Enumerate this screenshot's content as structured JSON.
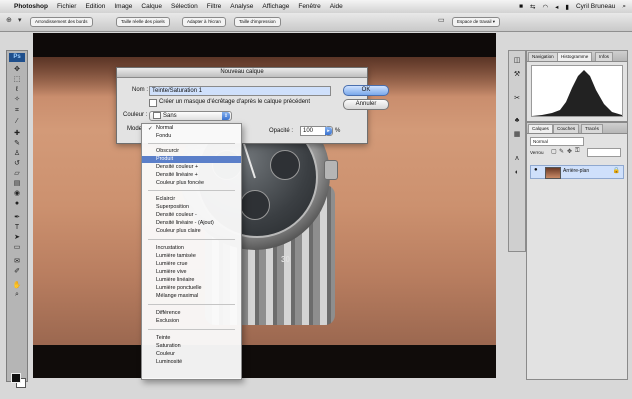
{
  "menubar": {
    "apple_icon": "apple-icon",
    "app": "Photoshop",
    "items": [
      "Fichier",
      "Edition",
      "Image",
      "Calque",
      "Sélection",
      "Filtre",
      "Analyse",
      "Affichage",
      "Fenêtre",
      "Aide"
    ],
    "user": "Cyril Bruneau"
  },
  "options_bar": {
    "smooth_label": "Arrondissement des bords",
    "refine_label": "Taille réelle des pixels",
    "fit_label": "Adapter à l'écran",
    "fill_label": "Taille d'impression",
    "workspace_label": "Espace de travail ▾"
  },
  "toolbox": {
    "logo": "Ps",
    "tools": [
      "move-icon",
      "marquee-icon",
      "lasso-icon",
      "wand-icon",
      "crop-icon",
      "eyedropper-icon",
      "heal-icon",
      "brush-icon",
      "stamp-icon",
      "history-brush-icon",
      "eraser-icon",
      "gradient-icon",
      "blur-icon",
      "dodge-icon",
      "pen-icon",
      "type-icon",
      "path-select-icon",
      "shape-icon",
      "notes-icon",
      "hand-icon",
      "zoom-icon"
    ]
  },
  "dialog": {
    "title": "Nouveau calque",
    "name_label": "Nom :",
    "name_value": "Teinte/Saturation 1",
    "clip_label": "Créer un masque d'écrêtage d'après le calque précédent",
    "color_label": "Couleur :",
    "color_value": "Sans",
    "mode_label": "Mode :",
    "opacity_label": "Opacité :",
    "opacity_value": "100",
    "opacity_unit": "%",
    "ok": "OK",
    "cancel": "Annuler"
  },
  "blend_modes": {
    "groups": [
      [
        "Normal",
        "Fondu"
      ],
      [
        "Obscurcir",
        "Produit",
        "Densité couleur +",
        "Densité linéaire +",
        "Couleur plus foncée"
      ],
      [
        "Eclaircir",
        "Superposition",
        "Densité couleur -",
        "Densité linéaire - (Ajout)",
        "Couleur plus claire"
      ],
      [
        "Incrustation",
        "Lumière tamisée",
        "Lumière crue",
        "Lumière vive",
        "Lumière linéaire",
        "Lumière ponctuelle",
        "Mélange maximal"
      ],
      [
        "Différence",
        "Exclusion"
      ],
      [
        "Teinte",
        "Saturation",
        "Couleur",
        "Luminosité"
      ]
    ],
    "checked": "Normal",
    "highlighted": "Produit"
  },
  "panels": {
    "top_tabs": [
      "Navigation",
      "Histogramme",
      "Infos"
    ],
    "layer_tabs": [
      "Calques",
      "Couches",
      "Tracés"
    ],
    "blend_select": "Normal",
    "lock_label": "Verrou",
    "layer_name": "Arrière-plan"
  },
  "watch_dial_number": "30"
}
